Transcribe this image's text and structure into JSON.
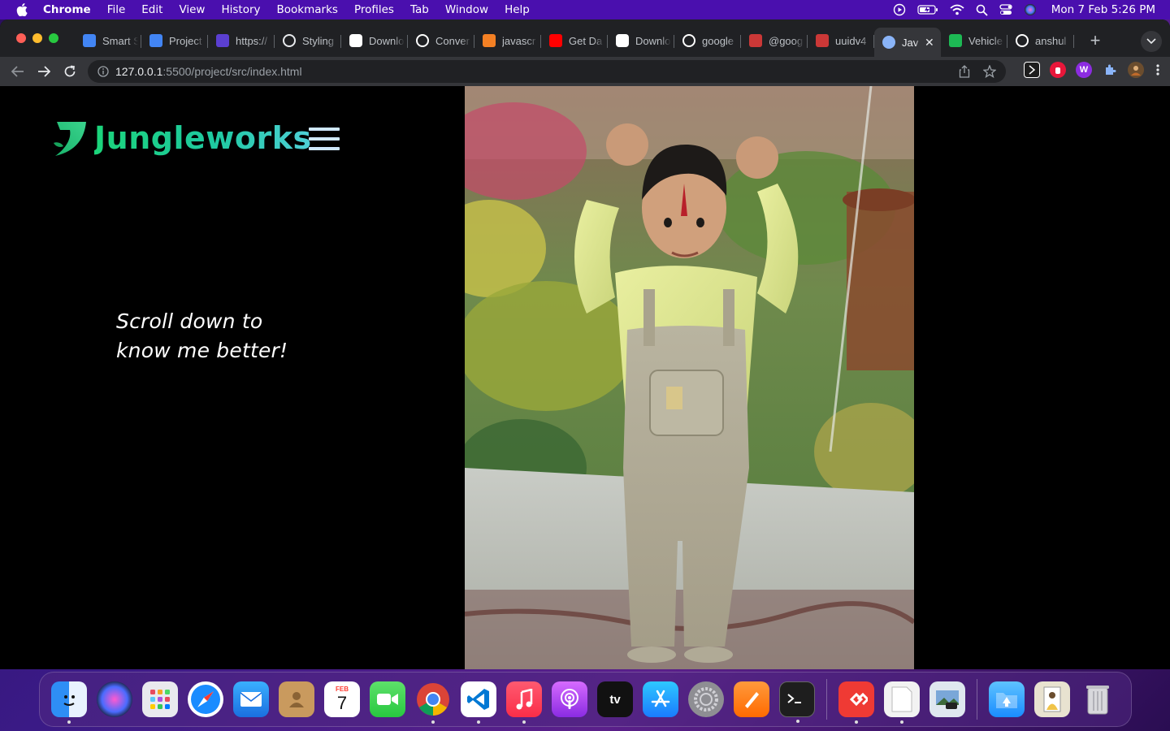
{
  "menubar": {
    "app": "Chrome",
    "items": [
      "File",
      "Edit",
      "View",
      "History",
      "Bookmarks",
      "Profiles",
      "Tab",
      "Window",
      "Help"
    ],
    "clock": "Mon 7 Feb  5:26 PM"
  },
  "browser": {
    "tabs": [
      {
        "label": "Smart S",
        "icon": "google-docs-icon",
        "color": "#4285f4"
      },
      {
        "label": "Project",
        "icon": "google-docs-icon",
        "color": "#4285f4"
      },
      {
        "label": "https://",
        "icon": "web3-icon",
        "color": "#5b3fd1"
      },
      {
        "label": "Styling",
        "icon": "openai-icon",
        "color": "#e8eaed"
      },
      {
        "label": "Downlo",
        "icon": "download-site-icon",
        "color": "#ffffff"
      },
      {
        "label": "Conver",
        "icon": "github-icon",
        "color": "#ffffff"
      },
      {
        "label": "javascr",
        "icon": "stackoverflow-icon",
        "color": "#f48024"
      },
      {
        "label": "Get Da",
        "icon": "youtube-icon",
        "color": "#ff0000"
      },
      {
        "label": "Downlo",
        "icon": "download-site-icon",
        "color": "#ffffff"
      },
      {
        "label": "google",
        "icon": "github-icon",
        "color": "#ffffff"
      },
      {
        "label": "@goog",
        "icon": "npm-icon",
        "color": "#cb3837"
      },
      {
        "label": "uuidv4",
        "icon": "npm-icon",
        "color": "#cb3837"
      },
      {
        "label": "Jav",
        "icon": "globe-icon",
        "color": "#8ab4f8",
        "active": true
      },
      {
        "label": "Vehicle",
        "icon": "green-app-icon",
        "color": "#1db954"
      },
      {
        "label": "anshul",
        "icon": "github-icon",
        "color": "#ffffff"
      }
    ],
    "url_host": "127.0.0.1",
    "url_path": ":5500/project/src/index.html"
  },
  "page": {
    "brand": "Jungleworks",
    "tagline_line1": "Scroll down to",
    "tagline_line2": "know me better!",
    "photo_alt": "profile photo"
  },
  "dock": {
    "apps": [
      "Finder",
      "Siri",
      "Launchpad",
      "Safari",
      "Mail",
      "Contacts",
      "Calendar",
      "FaceTime",
      "Chrome",
      "VS Code",
      "Music",
      "Podcasts",
      "TV",
      "App Store",
      "System Preferences",
      "Pages",
      "Terminal",
      "AnyDesk",
      "Document",
      "Preview",
      "Downloads",
      "Image",
      "Trash"
    ],
    "calendar_month": "FEB",
    "calendar_day": "7"
  },
  "colors": {
    "menubar": "#4a0fae",
    "brand_green": "#1bd47a",
    "brand_cyan": "#4fd0d8",
    "hamburger": "#cfe8ff"
  }
}
